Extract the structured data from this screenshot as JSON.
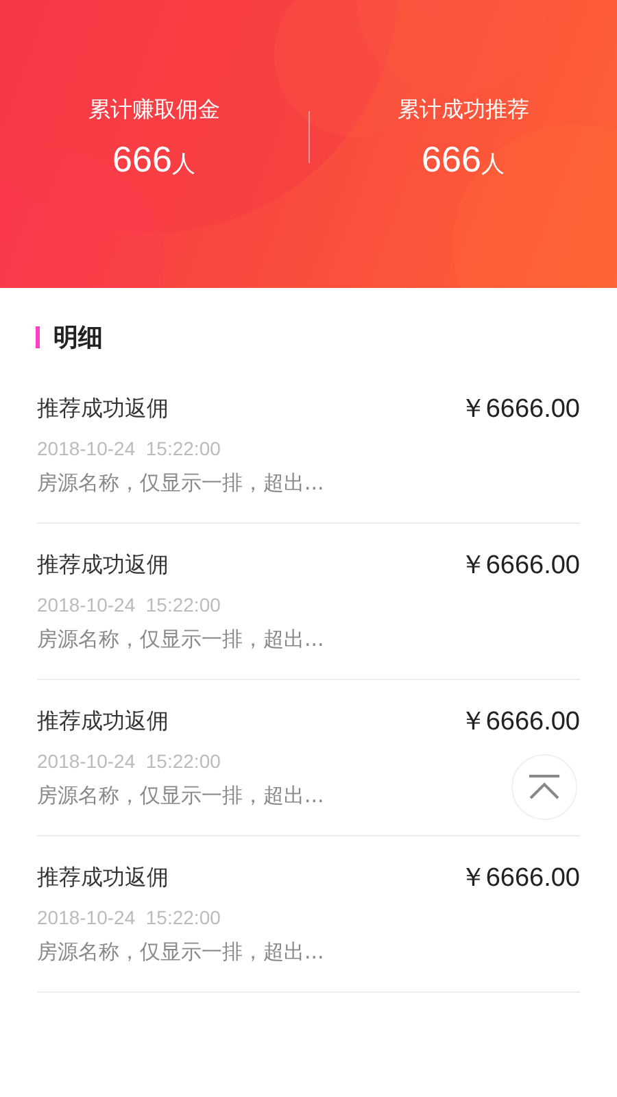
{
  "stats": [
    {
      "label": "累计赚取佣金",
      "value": "666",
      "unit": "人"
    },
    {
      "label": "累计成功推荐",
      "value": "666",
      "unit": "人"
    }
  ],
  "section_title": "明细",
  "records": [
    {
      "title": "推荐成功返佣",
      "amount": "￥6666.00",
      "time": "2018-10-24  15:22:00",
      "description": "房源名称，仅显示一排，超出..."
    },
    {
      "title": "推荐成功返佣",
      "amount": "￥6666.00",
      "time": "2018-10-24  15:22:00",
      "description": "房源名称，仅显示一排，超出..."
    },
    {
      "title": "推荐成功返佣",
      "amount": "￥6666.00",
      "time": "2018-10-24  15:22:00",
      "description": "房源名称，仅显示一排，超出..."
    },
    {
      "title": "推荐成功返佣",
      "amount": "￥6666.00",
      "time": "2018-10-24  15:22:00",
      "description": "房源名称，仅显示一排，超出..."
    }
  ]
}
